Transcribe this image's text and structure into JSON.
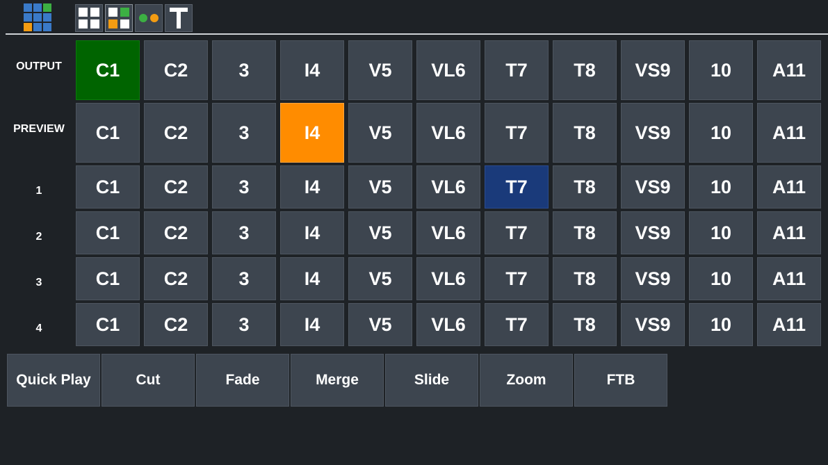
{
  "toolbar": {
    "logo_icon": "grid-logo-icon",
    "buttons": [
      {
        "icon": "grid-2x2-icon"
      },
      {
        "icon": "grid-2x2-colored-icon"
      },
      {
        "icon": "dots-icon"
      },
      {
        "icon": "text-T-icon",
        "glyph": "T"
      }
    ]
  },
  "rows": [
    {
      "label": "OUTPUT",
      "tiles": [
        "C1",
        "C2",
        "3",
        "I4",
        "V5",
        "VL6",
        "T7",
        "T8",
        "VS9",
        "10",
        "A11"
      ]
    },
    {
      "label": "PREVIEW",
      "tiles": [
        "C1",
        "C2",
        "3",
        "I4",
        "V5",
        "VL6",
        "T7",
        "T8",
        "VS9",
        "10",
        "A11"
      ]
    },
    {
      "label": "1",
      "tiles": [
        "C1",
        "C2",
        "3",
        "I4",
        "V5",
        "VL6",
        "T7",
        "T8",
        "VS9",
        "10",
        "A11"
      ]
    },
    {
      "label": "2",
      "tiles": [
        "C1",
        "C2",
        "3",
        "I4",
        "V5",
        "VL6",
        "T7",
        "T8",
        "VS9",
        "10",
        "A11"
      ]
    },
    {
      "label": "3",
      "tiles": [
        "C1",
        "C2",
        "3",
        "I4",
        "V5",
        "VL6",
        "T7",
        "T8",
        "VS9",
        "10",
        "A11"
      ]
    },
    {
      "label": "4",
      "tiles": [
        "C1",
        "C2",
        "3",
        "I4",
        "V5",
        "VL6",
        "T7",
        "T8",
        "VS9",
        "10",
        "A11"
      ]
    }
  ],
  "state": {
    "output_active": "C1",
    "preview_active": "I4",
    "row1_selected": "T7"
  },
  "transitions": [
    "Quick Play",
    "Cut",
    "Fade",
    "Merge",
    "Slide",
    "Zoom",
    "FTB"
  ],
  "colors": {
    "background": "#1e2226",
    "tile": "#3d454f",
    "program": "#006400",
    "preview": "#ff8c00",
    "selected": "#1a3a7a"
  }
}
